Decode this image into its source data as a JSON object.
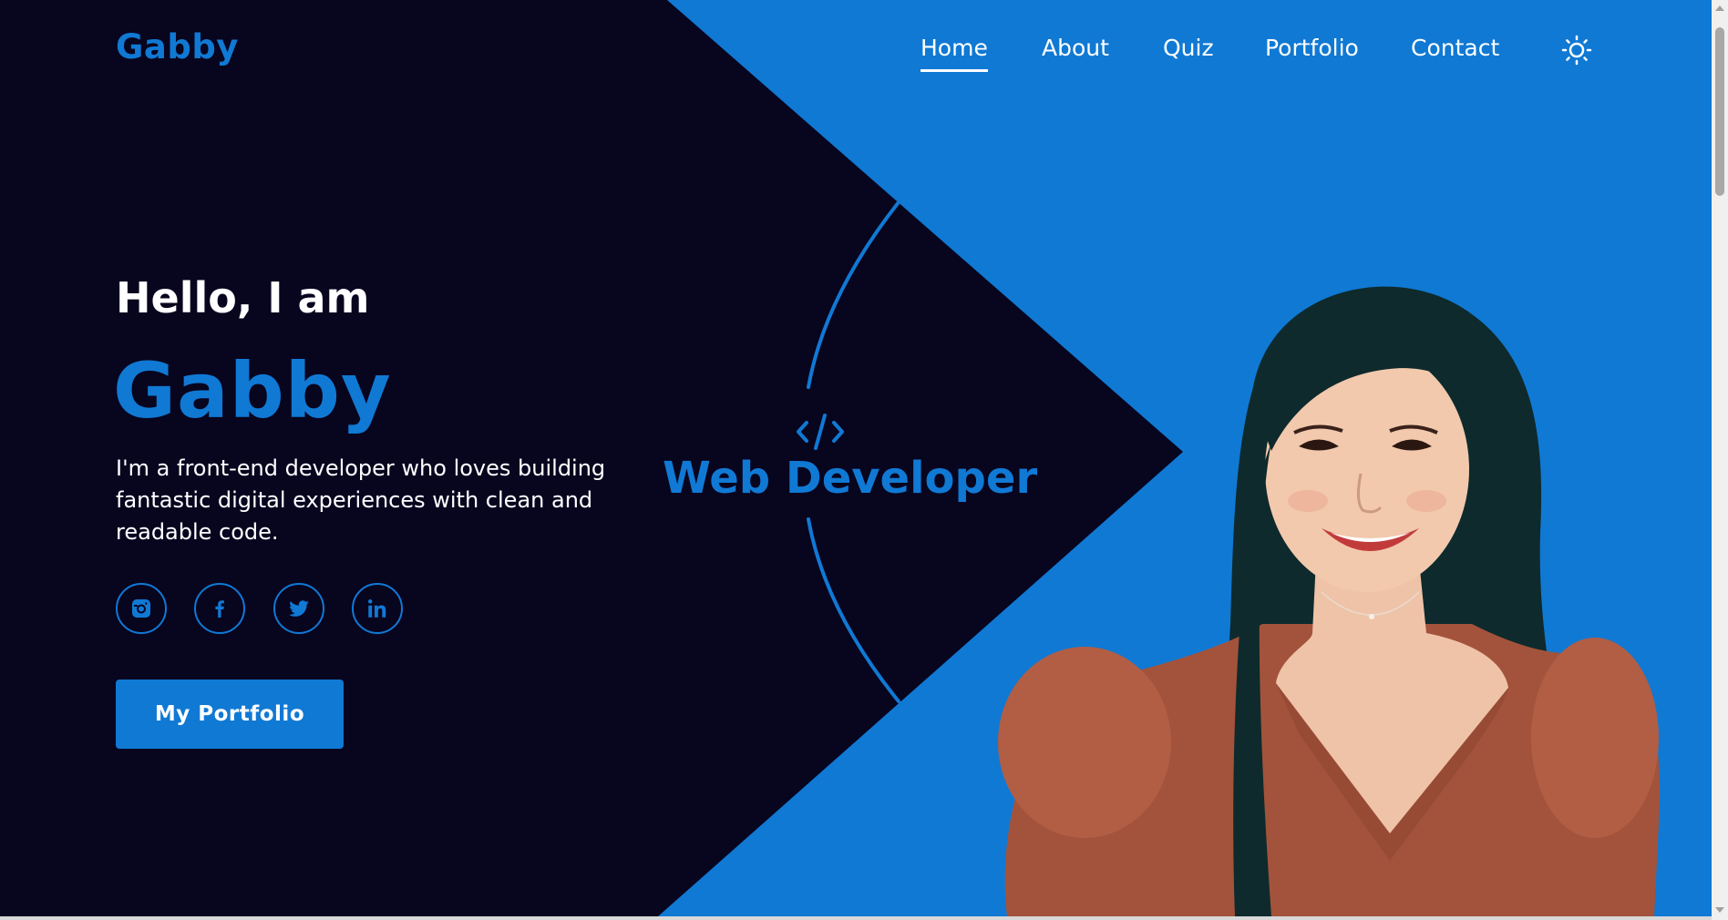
{
  "header": {
    "logo": "Gabby",
    "nav": [
      {
        "label": "Home",
        "active": true
      },
      {
        "label": "About",
        "active": false
      },
      {
        "label": "Quiz",
        "active": false
      },
      {
        "label": "Portfolio",
        "active": false
      },
      {
        "label": "Contact",
        "active": false
      }
    ],
    "theme_toggle_icon": "sun-icon"
  },
  "hero": {
    "greeting": "Hello, I am",
    "name": "Gabby",
    "description": "I'm a front-end developer who loves building fantastic digital experiences with clean and readable code.",
    "socials": [
      {
        "icon": "instagram-icon"
      },
      {
        "icon": "facebook-icon"
      },
      {
        "icon": "twitter-icon"
      },
      {
        "icon": "linkedin-icon"
      }
    ],
    "cta_label": "My Portfolio"
  },
  "badge": {
    "icon": "code-icon",
    "role": "Web Developer"
  },
  "colors": {
    "dark": "#08051f",
    "accent": "#1079d4",
    "text": "#ffffff"
  }
}
